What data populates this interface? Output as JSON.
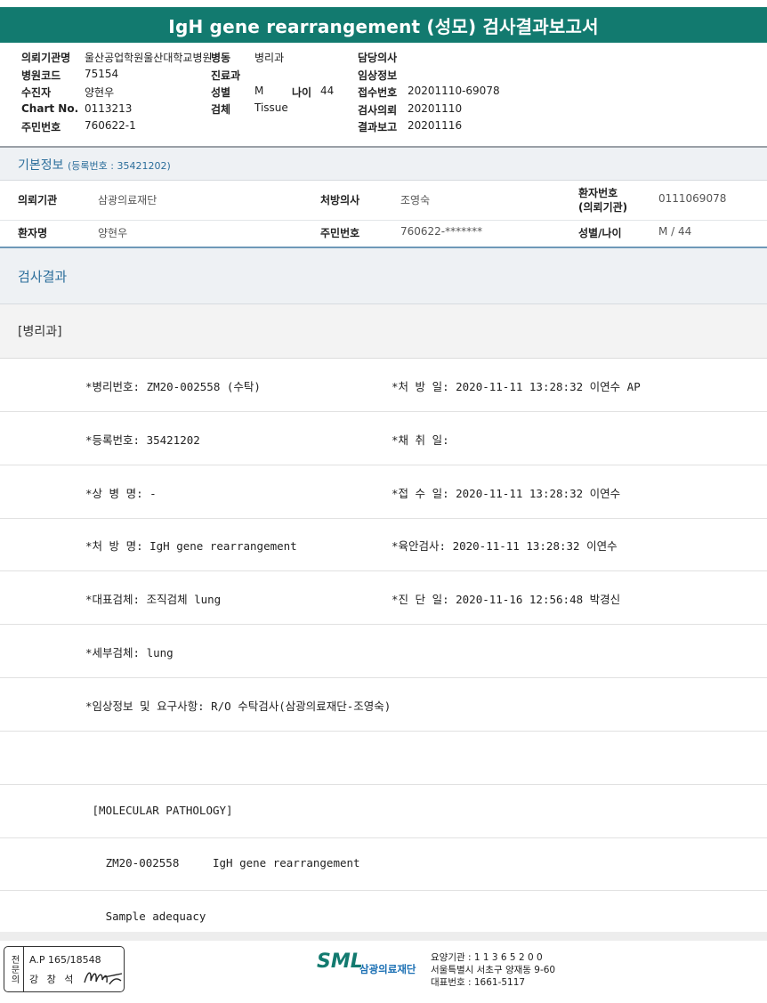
{
  "title": "IgH gene rearrangement (성모) 검사결과보고서",
  "header": {
    "req_institution_label": "의뢰기관명",
    "req_institution_value": "울산공업학원울산대학교병원",
    "ward_label": "병동",
    "ward_value": "병리과",
    "doctor_label": "담당의사",
    "hospital_code_label": "병원코드",
    "hospital_code_value": "75154",
    "dept_label": "진료과",
    "clinical_info_label": "임상정보",
    "patient_label": "수진자",
    "patient_value": "양현우",
    "sex_label": "성별",
    "sex_value": "M",
    "age_label": "나이",
    "age_value": "44",
    "receipt_label": "접수번호",
    "receipt_value": "20201110-69078",
    "chart_label": "Chart No.",
    "chart_value": "0113213",
    "specimen_label": "검체",
    "specimen_value": "Tissue",
    "request_label": "검사의뢰",
    "request_value": "20201110",
    "rrn_label": "주민번호",
    "rrn_value": "760622-1",
    "report_label": "결과보고",
    "report_value": "20201116"
  },
  "basic_info": {
    "title": "기본정보",
    "reg": "(등록번호 : 35421202)",
    "row1": {
      "inst_label": "의뢰기관",
      "inst_value": "삼광의료재단",
      "doctor_label": "처방의사",
      "doctor_value": "조영숙",
      "pid_label1": "환자번호",
      "pid_label2": "(의뢰기관)",
      "pid_value": "0111069078"
    },
    "row2": {
      "name_label": "환자명",
      "name_value": "양현우",
      "rrn_label": "주민번호",
      "rrn_value": "760622-*******",
      "sexage_label": "성별/나이",
      "sexage_value": "M / 44"
    }
  },
  "results": {
    "title": "검사결과",
    "dept": "[병리과]",
    "rows": [
      {
        "left": "*병리번호: ZM20-002558 (수탁)",
        "right": "*처 방 일: 2020-11-11 13:28:32  이연수 AP"
      },
      {
        "left": "*등록번호: 35421202",
        "right": "*채 취 일:"
      },
      {
        "left": "*상 병 명: -",
        "right": "*접 수 일: 2020-11-11 13:28:32  이연수"
      },
      {
        "left": "*처 방 명: IgH gene rearrangement",
        "right": "*육안검사: 2020-11-11 13:28:32  이연수"
      },
      {
        "left": "*대표검체: 조직검체 lung",
        "right": "*진 단 일: 2020-11-16 12:56:48  박경신"
      },
      {
        "left": "*세부검체: lung",
        "right": ""
      },
      {
        "left": "*임상정보 및 요구사항: R/O 수탁검사(삼광의료재단-조영숙)",
        "right": ""
      },
      {
        "left": "",
        "right": ""
      },
      {
        "left": " [MOLECULAR PATHOLOGY]",
        "right": ""
      },
      {
        "left": "   ZM20-002558     IgH gene rearrangement",
        "right": ""
      },
      {
        "left": "   Sample adequacy",
        "right": ""
      }
    ]
  },
  "footer": {
    "vert_label": "전문의",
    "ap_line": "A.P 165/18548",
    "name_line": "강 창 석",
    "logo_text": "SML",
    "logo_name": "삼광의료재단",
    "org_line1": "요양기관 : 1 1 3 6 5 2 0 0",
    "org_line2": "서울특별시 서초구 양재동 9-60",
    "org_line3": "대표번호 : 1661-5117"
  }
}
